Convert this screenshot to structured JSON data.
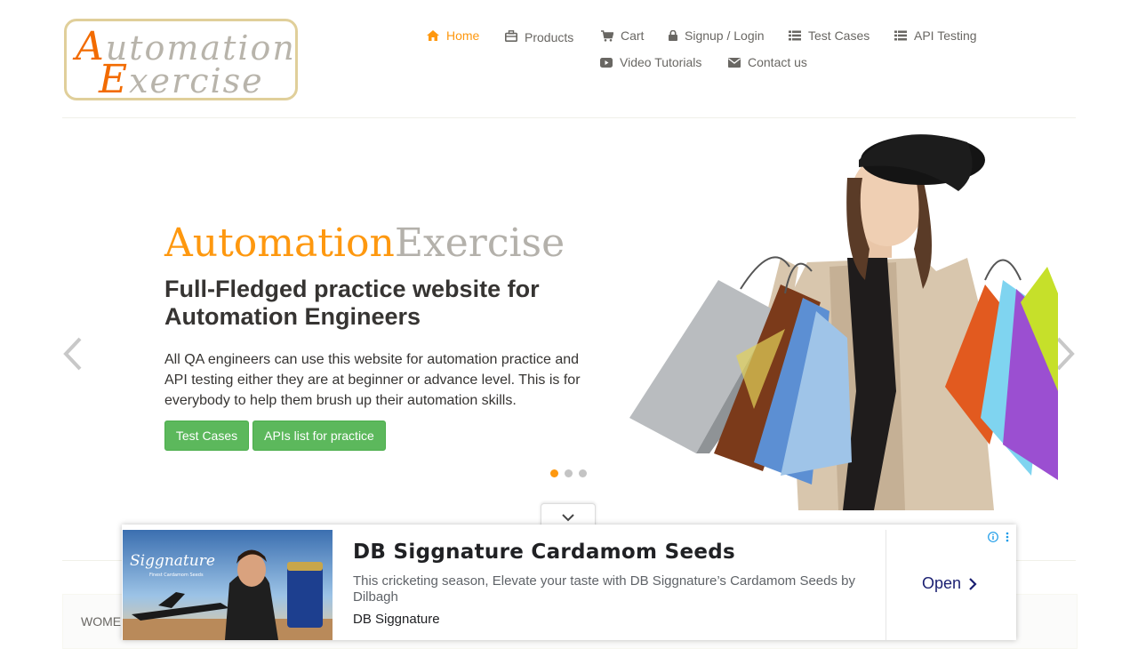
{
  "logo": {
    "line1_first": "A",
    "line1_rest": "utomation",
    "line2_first": "E",
    "line2_rest": "xercise"
  },
  "nav": {
    "items": [
      {
        "label": "Home",
        "icon": "home-icon",
        "active": true
      },
      {
        "label": "Products",
        "icon": "briefcase-icon"
      },
      {
        "label": "Cart",
        "icon": "cart-icon"
      },
      {
        "label": "Signup / Login",
        "icon": "lock-icon"
      },
      {
        "label": "Test Cases",
        "icon": "list-icon"
      },
      {
        "label": "API Testing",
        "icon": "list-icon"
      },
      {
        "label": "Video Tutorials",
        "icon": "youtube-play-icon"
      },
      {
        "label": "Contact us",
        "icon": "envelope-icon"
      }
    ]
  },
  "hero": {
    "title_a": "Automation",
    "title_b": "Exercise",
    "subtitle": "Full-Fledged practice website for Automation Engineers",
    "text": "All QA engineers can use this website for automation practice and API testing either they are at beginner or advance level. This is for everybody to help them brush up their automation skills.",
    "btn_test_cases": "Test Cases",
    "btn_apis": "APIs list for practice",
    "active_slide": 1,
    "slides": 3
  },
  "category": {
    "label": "WOME"
  },
  "ad": {
    "title": "DB Siggnature Cardamom Seeds",
    "description": "This cricketing season, Elevate your taste with DB Siggnature’s Cardamom Seeds by Dilbagh",
    "brand": "DB Siggnature",
    "open_label": "Open",
    "image_brand_text": "Siggnature",
    "image_tagline": "Finest Cardamom Seeds"
  },
  "colors": {
    "accent": "#fe980f",
    "button": "#5cb85c",
    "title_gray": "#b4b1ab",
    "ad_link": "#1a1f71"
  }
}
